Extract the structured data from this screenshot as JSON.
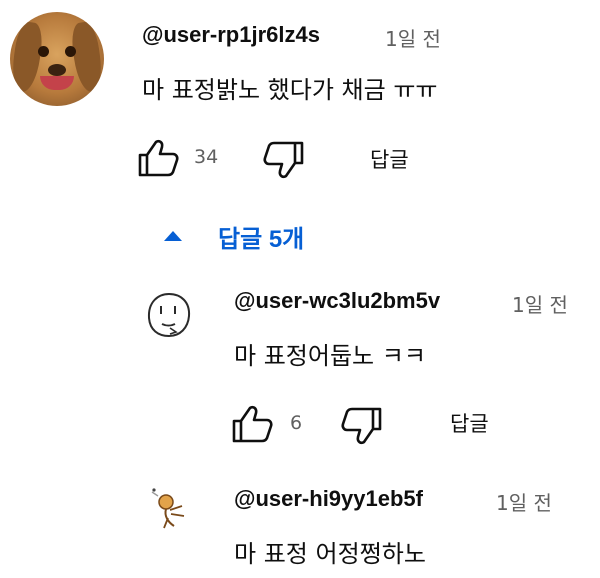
{
  "comment": {
    "author": "@user-rp1jr6lz4s",
    "time": "1일 전",
    "text": "마 표정밝노 했다가 채금 ㅠㅠ",
    "likes": "34",
    "reply_label": "답글",
    "avatar": "dog-avatar"
  },
  "replies_toggle": {
    "label": "답글 5개",
    "icon": "caret-up-icon",
    "color": "#065fd4"
  },
  "replies": [
    {
      "author": "@user-wc3lu2bm5v",
      "time": "1일 전",
      "text": "마 표정어둡노 ㅋㅋ",
      "likes": "6",
      "reply_label": "답글",
      "avatar": "face-sketch-avatar"
    },
    {
      "author": "@user-hi9yy1eb5f",
      "time": "1일 전",
      "text": "마 표정 어정쩡하노",
      "avatar": "sketch-avatar"
    }
  ],
  "icons": {
    "like": "thumbs-up-icon",
    "dislike": "thumbs-down-icon"
  }
}
